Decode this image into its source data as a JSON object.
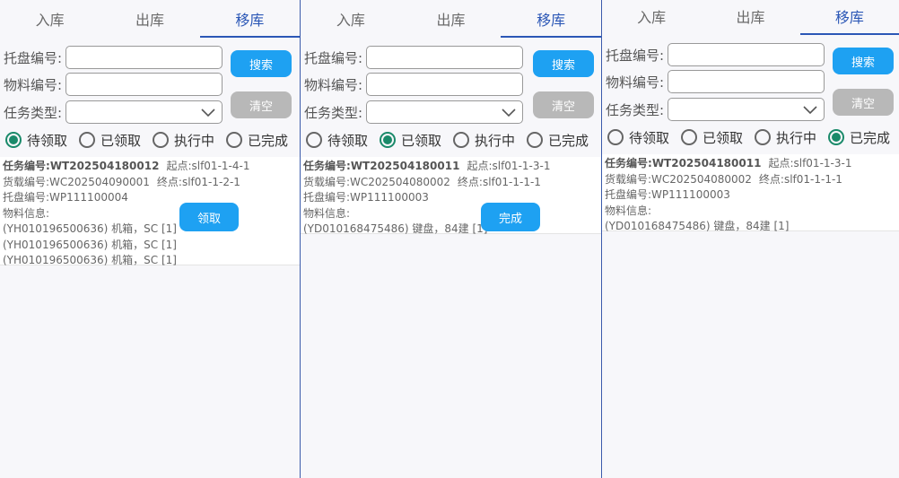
{
  "tabs": [
    "入库",
    "出库",
    "移库"
  ],
  "form": {
    "pallet_label": "托盘编号:",
    "material_label": "物料编号:",
    "task_type_label": "任务类型:",
    "pallet_value": "",
    "material_value": "",
    "task_type_value": "",
    "search_label": "搜索",
    "clear_label": "清空"
  },
  "status_options": [
    "待领取",
    "已领取",
    "执行中",
    "已完成"
  ],
  "panels": [
    {
      "active_tab": "移库",
      "selected_status": "待领取",
      "task": {
        "task_no_label": "任务编号:",
        "task_no": "WT202504180012",
        "start_label": "起点:",
        "start": "slf01-1-4-1",
        "carrier_label": "货载编号:",
        "carrier": "WC202504090001",
        "end_label": "终点:",
        "end": "slf01-1-2-1",
        "pallet_label": "托盘编号:",
        "pallet": "WP111100004",
        "material_info_label": "物料信息:",
        "materials": [
          "(YH010196500636) 机箱，SC [1]",
          "(YH010196500636) 机箱，SC [1]",
          "(YH010196500636) 机箱，SC [1]"
        ],
        "action_label": "领取"
      }
    },
    {
      "active_tab": "移库",
      "selected_status": "已领取",
      "task": {
        "task_no_label": "任务编号:",
        "task_no": "WT202504180011",
        "start_label": "起点:",
        "start": "slf01-1-3-1",
        "carrier_label": "货载编号:",
        "carrier": "WC202504080002",
        "end_label": "终点:",
        "end": "slf01-1-1-1",
        "pallet_label": "托盘编号:",
        "pallet": "WP111100003",
        "material_info_label": "物料信息:",
        "materials": [
          "(YD010168475486) 键盘，84建 [1]"
        ],
        "action_label": "完成"
      }
    },
    {
      "active_tab": "移库",
      "selected_status": "已完成",
      "task": {
        "task_no_label": "任务编号:",
        "task_no": "WT202504180011",
        "start_label": "起点:",
        "start": "slf01-1-3-1",
        "carrier_label": "货载编号:",
        "carrier": "WC202504080002",
        "end_label": "终点:",
        "end": "slf01-1-1-1",
        "pallet_label": "托盘编号:",
        "pallet": "WP111100003",
        "material_info_label": "物料信息:",
        "materials": [
          "(YD010168475486) 键盘，84建 [1]"
        ]
      }
    }
  ],
  "colors": {
    "accent": "#2b57b6",
    "button_blue": "#1ea1f2",
    "button_gray": "#b8b8b8",
    "radio_selected": "#1a8a6a"
  }
}
